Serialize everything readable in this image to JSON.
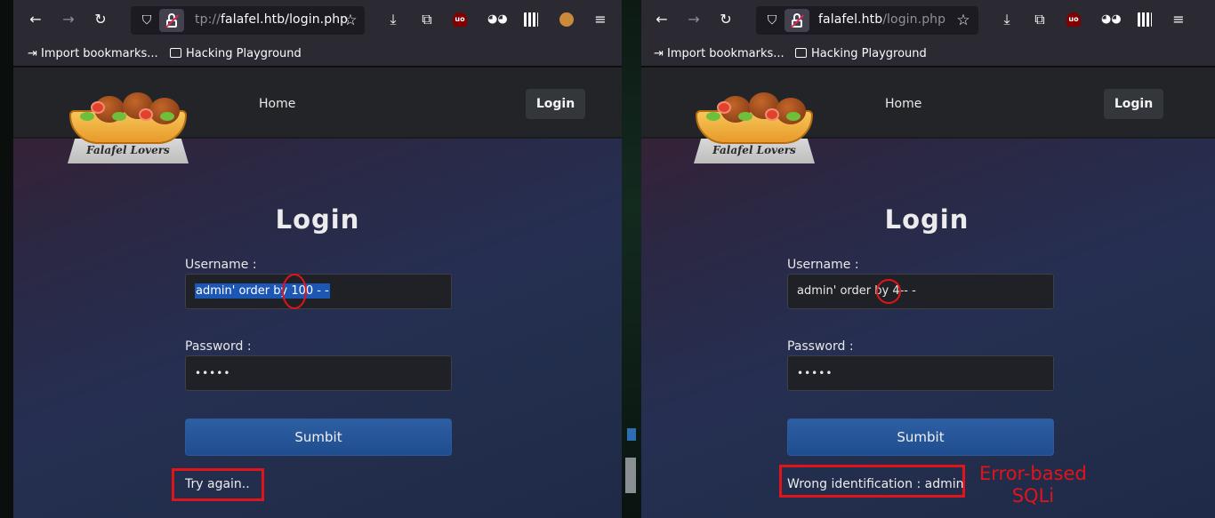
{
  "windows": [
    {
      "url_left_fragment": "tp://",
      "url_host": "falafel.htb",
      "url_path": "/login.php",
      "bookmarks": {
        "import": "Import bookmarks...",
        "folder": "Hacking Playground"
      },
      "nav": {
        "home": "Home",
        "login": "Login"
      },
      "logo_text": "Falafel Lovers",
      "page_title": "Login",
      "username_label": "Username :",
      "username_selected": "admin' order by 100 - -",
      "password_label": "Password :",
      "password_value": "•••••",
      "submit_label": "Sumbit",
      "message": "Try again.."
    },
    {
      "url_host": "falafel.htb",
      "url_path": "/login.php",
      "bookmarks": {
        "import": "Import bookmarks...",
        "folder": "Hacking Playground"
      },
      "nav": {
        "home": "Home",
        "login": "Login"
      },
      "logo_text": "Falafel Lovers",
      "page_title": "Login",
      "username_value": "admin' order by 4-- -",
      "password_label": "Password :",
      "username_label": "Username :",
      "password_value": "•••••",
      "submit_label": "Sumbit",
      "message": "Wrong identification : admin"
    }
  ],
  "annotation": {
    "line1": "Error-based",
    "line2": "SQLi",
    "color": "#e1141a"
  },
  "icons": [
    "back-arrow-icon",
    "forward-arrow-icon",
    "reload-icon",
    "shield-icon",
    "insecure-lock-icon",
    "star-icon",
    "download-icon",
    "extensions-icon",
    "ublock-icon",
    "owl-icon",
    "qr-icon",
    "cookie-icon",
    "menu-icon",
    "import-icon",
    "folder-icon"
  ]
}
